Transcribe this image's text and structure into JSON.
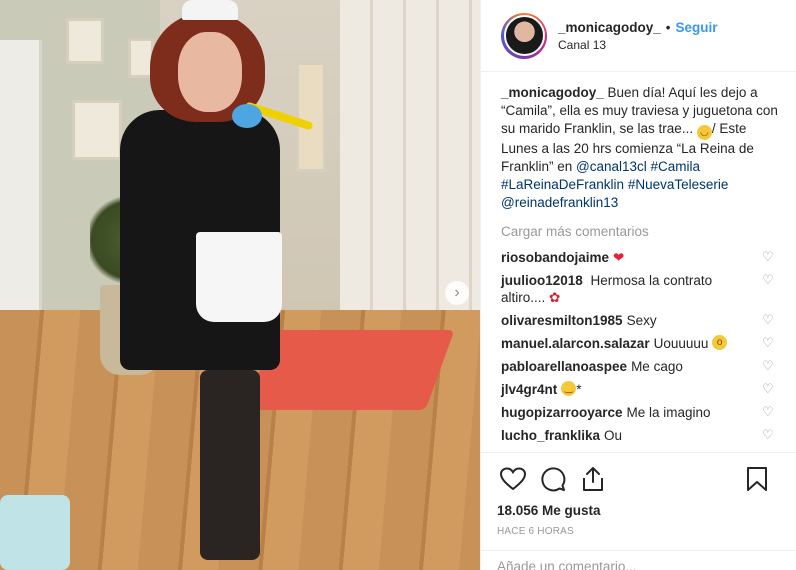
{
  "post": {
    "username": "_monicagodoy_",
    "follow_label": "Seguir",
    "separator": "•",
    "location": "Canal 13",
    "caption_user": "_monicagodoy_",
    "caption_text_1": " Buen día! Aquí les dejo a “Camila”, ella es muy traviesa y juguetona con su marido Franklin, se las trae... ",
    "caption_text_2": "/ Este Lunes a las 20 hrs comienza “La Reina de Franklin” en ",
    "caption_mention_1": "@canal13cl",
    "caption_hashtag_1": "#Camila",
    "caption_hashtag_2": "#LaReinaDeFranklin",
    "caption_hashtag_3": "#NuevaTeleserie",
    "caption_mention_2": "@reinadefranklin13",
    "load_more": "Cargar más comentarios",
    "likes": "18.056 Me gusta",
    "time": "HACE 6 HORAS",
    "add_comment_placeholder": "Añade un comentario..."
  },
  "comments": [
    {
      "user": "riosobandojaime",
      "text": ""
    },
    {
      "user": "juulioo12018",
      "text": "Hermosa la contrato altiro...."
    },
    {
      "user": "olivaresmilton1985",
      "text": "Sexy"
    },
    {
      "user": "manuel.alarcon.salazar",
      "text": "Uouuuuu"
    },
    {
      "user": "pabloarellanoaspee",
      "text": "Me cago"
    },
    {
      "user": "jlv4gr4nt",
      "text": "*"
    },
    {
      "user": "hugopizarrooyarce",
      "text": "Me la imagino"
    },
    {
      "user": "lucho_franklika",
      "text": "Ou"
    }
  ],
  "colors": {
    "link": "#003569",
    "follow": "#3897f0",
    "muted": "#999999"
  }
}
